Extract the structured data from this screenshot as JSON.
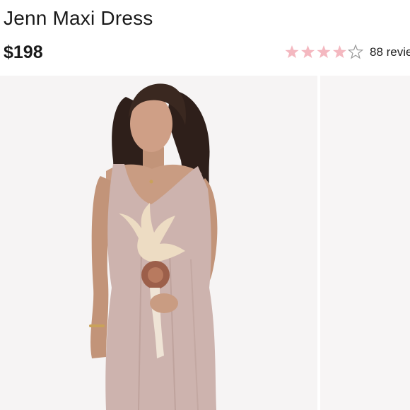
{
  "product": {
    "title": "Jenn Maxi Dress",
    "price": "$198"
  },
  "rating": {
    "value": 4,
    "max": 5,
    "review_count_text": "88 revie"
  },
  "icons": {
    "star_filled": "star-icon",
    "star_empty": "star-outline-icon",
    "star_color": "#f4b8c0",
    "star_empty_color": "#9a9a9a"
  },
  "colors": {
    "dress": "#cdb3ae",
    "skin": "#c99c82",
    "hair": "#2e1f1a",
    "bouquet": "#eddcc3",
    "background": "#f6f4f4"
  }
}
